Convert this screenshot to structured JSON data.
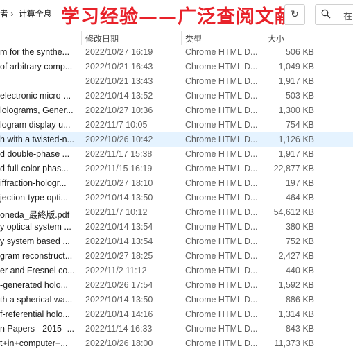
{
  "breadcrumb": {
    "parent": "者",
    "separator": "›",
    "current": "计算全息"
  },
  "watermark": "学习经验——广泛查阅文献",
  "search": {
    "placeholder": "在"
  },
  "columns": {
    "date": "修改日期",
    "type": "类型",
    "size": "大小"
  },
  "files": [
    {
      "name": "m for the synthe...",
      "date": "2022/10/27 16:19",
      "type": "Chrome HTML D...",
      "size": "506 KB"
    },
    {
      "name": "of arbitrary comp...",
      "date": "2022/10/21 16:43",
      "type": "Chrome HTML D...",
      "size": "1,049 KB"
    },
    {
      "name": "",
      "date": "2022/10/21 13:43",
      "type": "Chrome HTML D...",
      "size": "1,917 KB"
    },
    {
      "name": "electronic micro-...",
      "date": "2022/10/14 13:52",
      "type": "Chrome HTML D...",
      "size": "503 KB"
    },
    {
      "name": "lolograms, Gener...",
      "date": "2022/10/27 10:36",
      "type": "Chrome HTML D...",
      "size": "1,300 KB"
    },
    {
      "name": "logram display u...",
      "date": "2022/11/7 10:05",
      "type": "Chrome HTML D...",
      "size": "754 KB"
    },
    {
      "name": "h with a twisted-n...",
      "date": "2022/10/26 10:42",
      "type": "Chrome HTML D...",
      "size": "1,126 KB",
      "selected": true
    },
    {
      "name": "d double-phase ...",
      "date": "2022/11/17 15:38",
      "type": "Chrome HTML D...",
      "size": "1,917 KB"
    },
    {
      "name": "d full-color phas...",
      "date": "2022/11/15 16:19",
      "type": "Chrome HTML D...",
      "size": "22,877 KB"
    },
    {
      "name": "iffraction-hologr...",
      "date": "2022/10/27 18:10",
      "type": "Chrome HTML D...",
      "size": "197 KB"
    },
    {
      "name": "jection-type opti...",
      "date": "2022/10/14 13:50",
      "type": "Chrome HTML D...",
      "size": "464 KB"
    },
    {
      "name": "oneda_最終版.pdf",
      "date": "2022/11/7 10:12",
      "type": "Chrome HTML D...",
      "size": "54,612 KB"
    },
    {
      "name": "y optical system ...",
      "date": "2022/10/14 13:54",
      "type": "Chrome HTML D...",
      "size": "380 KB"
    },
    {
      "name": "y system based ...",
      "date": "2022/10/14 13:54",
      "type": "Chrome HTML D...",
      "size": "752 KB"
    },
    {
      "name": "gram reconstruct...",
      "date": "2022/10/27 18:25",
      "type": "Chrome HTML D...",
      "size": "2,427 KB"
    },
    {
      "name": "er and Fresnel co...",
      "date": "2022/11/2 11:12",
      "type": "Chrome HTML D...",
      "size": "440 KB"
    },
    {
      "name": "-generated holo...",
      "date": "2022/10/26 17:54",
      "type": "Chrome HTML D...",
      "size": "1,592 KB"
    },
    {
      "name": "th a spherical wa...",
      "date": "2022/10/14 13:50",
      "type": "Chrome HTML D...",
      "size": "886 KB"
    },
    {
      "name": "f-referential holo...",
      "date": "2022/10/14 14:16",
      "type": "Chrome HTML D...",
      "size": "1,314 KB"
    },
    {
      "name": "n Papers - 2015 -...",
      "date": "2022/11/14 16:33",
      "type": "Chrome HTML D...",
      "size": "843 KB"
    },
    {
      "name": "t+in+computer+...",
      "date": "2022/10/26 18:00",
      "type": "Chrome HTML D...",
      "size": "11,373 KB"
    }
  ],
  "colors": {
    "watermark": "#e8222a",
    "selected_row": "#e5f3ff",
    "secondary_text": "#5f5f5f"
  },
  "icons": {
    "refresh": "refresh-icon",
    "search": "search-icon"
  }
}
